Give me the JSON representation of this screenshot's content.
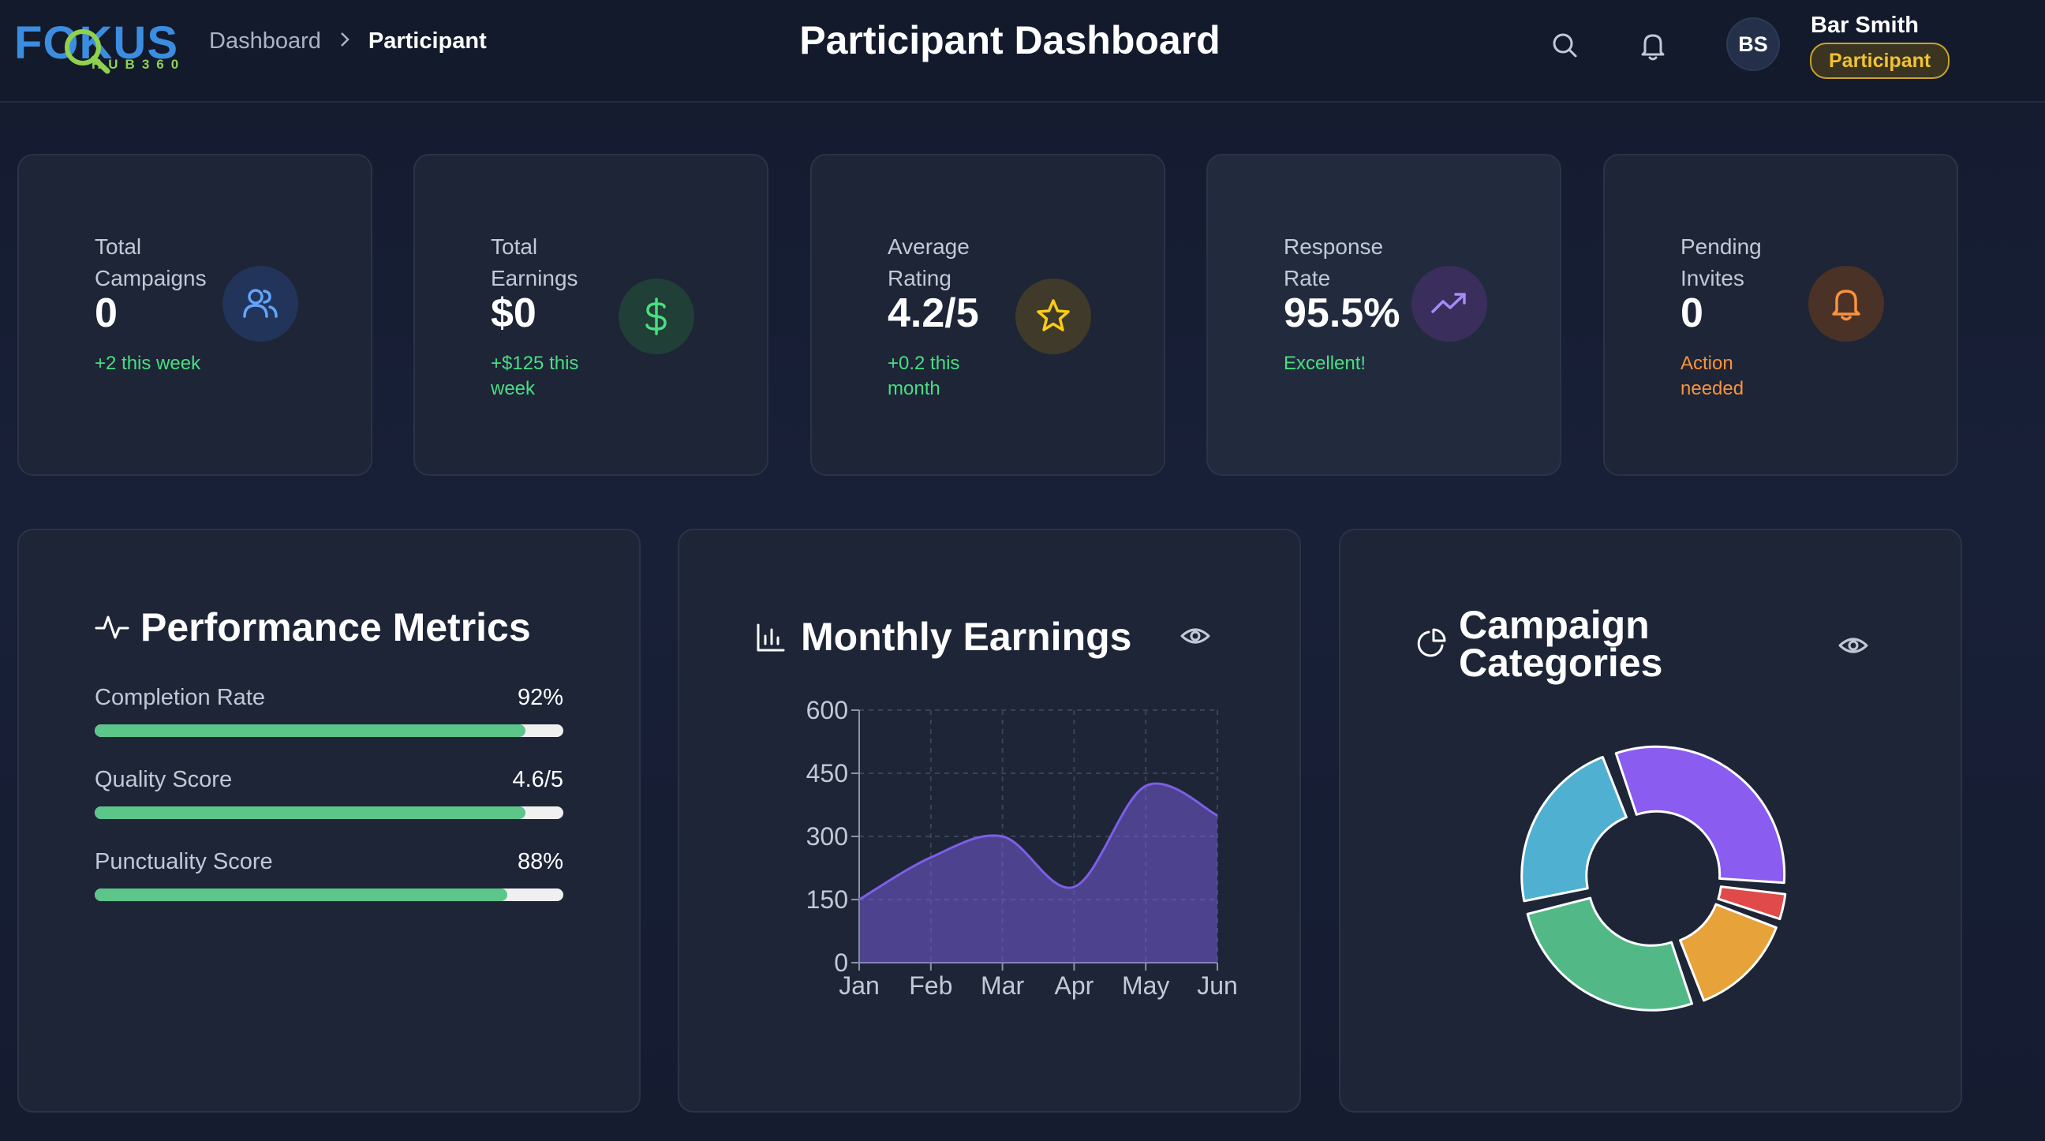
{
  "header": {
    "logo_text": "FOKUS",
    "logo_sub": "HUB360",
    "breadcrumb": [
      "Dashboard",
      "Participant"
    ],
    "page_title": "Participant Dashboard",
    "user": {
      "initials": "BS",
      "name": "Bar Smith",
      "role": "Participant"
    }
  },
  "stats": [
    {
      "label": "Total Campaigns",
      "value": "0",
      "sub": "+2 this week",
      "icon": "users-icon",
      "color": "#60a5fa"
    },
    {
      "label": "Total Earnings",
      "value": "$0",
      "sub": "+$125 this week",
      "icon": "dollar-icon",
      "color": "#4ade80"
    },
    {
      "label": "Average Rating",
      "value": "4.2/5",
      "sub": "+0.2 this month",
      "icon": "star-icon",
      "color": "#facc15"
    },
    {
      "label": "Response Rate",
      "value": "95.5%",
      "sub": "Excellent!",
      "icon": "trending-up-icon",
      "color": "#a78bfa"
    },
    {
      "label": "Pending Invites",
      "value": "0",
      "sub": "Action needed",
      "icon": "bell-icon",
      "color": "#fb923c"
    }
  ],
  "performance": {
    "title": "Performance Metrics",
    "metrics": [
      {
        "label": "Completion Rate",
        "value": "92%",
        "fraction": 0.92
      },
      {
        "label": "Quality Score",
        "value": "4.6/5",
        "fraction": 0.92
      },
      {
        "label": "Punctuality Score",
        "value": "88%",
        "fraction": 0.88
      }
    ]
  },
  "earnings": {
    "title": "Monthly Earnings"
  },
  "categories": {
    "title_line1": "Campaign",
    "title_line2": "Categories"
  },
  "chart_data": [
    {
      "type": "area",
      "categories": [
        "Jan",
        "Feb",
        "Mar",
        "Apr",
        "May",
        "Jun"
      ],
      "values": [
        150,
        250,
        300,
        180,
        420,
        350
      ],
      "ylim": [
        0,
        600
      ],
      "yticks": [
        0,
        150,
        300,
        450,
        600
      ],
      "grid": true,
      "color": "#7c5fe6"
    },
    {
      "type": "pie",
      "slices": [
        {
          "value": 32,
          "color": "#8a5cf0"
        },
        {
          "value": 4,
          "color": "#e14a4a"
        },
        {
          "value": 14,
          "color": "#e8a23a"
        },
        {
          "value": 27,
          "color": "#52b986"
        },
        {
          "value": 23,
          "color": "#4fb0d2"
        }
      ]
    }
  ]
}
